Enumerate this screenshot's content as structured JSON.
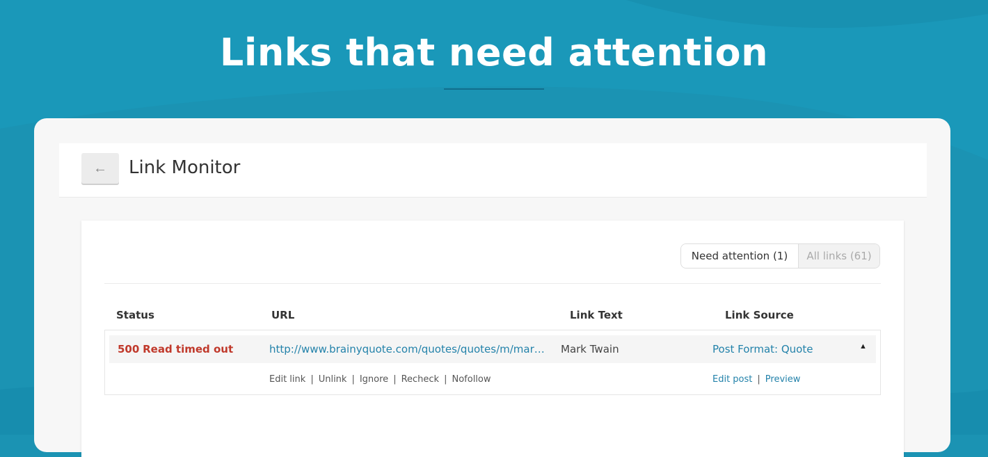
{
  "hero": {
    "title": "Links that need attention"
  },
  "header": {
    "back_icon": "←",
    "title": "Link Monitor"
  },
  "filters": {
    "need_attention": "Need attention (1)",
    "all_links": "All links (61)"
  },
  "table": {
    "columns": [
      "Status",
      "URL",
      "Link Text",
      "Link Source"
    ],
    "row": {
      "status_code": "500",
      "status_text": "Read timed out",
      "url": "http://www.brainyquote.com/quotes/quotes/m/markt…",
      "link_text": "Mark Twain",
      "link_source": "Post Format: Quote",
      "caret": "▲",
      "actions": [
        "Edit link",
        "Unlink",
        "Ignore",
        "Recheck",
        "Nofollow"
      ],
      "source_actions": [
        "Edit post",
        "Preview"
      ]
    }
  },
  "colors": {
    "background": "#1b93b3",
    "accent_link": "#2382aa",
    "error": "#c0392b"
  }
}
